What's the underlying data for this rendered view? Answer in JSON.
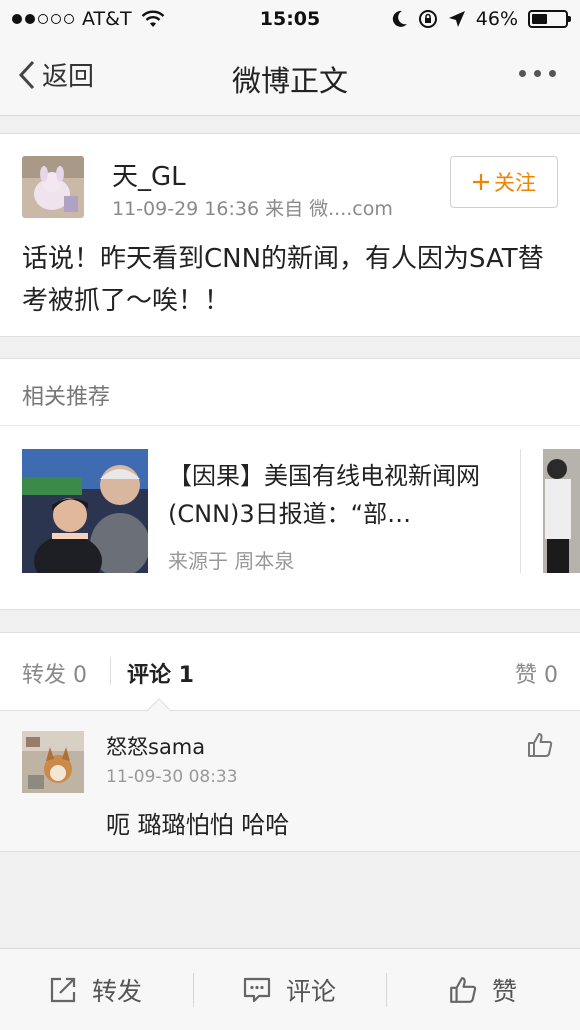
{
  "status_bar": {
    "carrier": "AT&T",
    "time": "15:05",
    "battery": "46%",
    "battery_level": 0.46,
    "signal_bars": 2
  },
  "nav": {
    "back_label": "返回",
    "title": "微博正文"
  },
  "post": {
    "author": "天_GL",
    "meta": "11-09-29 16:36  来自 微....com",
    "follow_label": "关注",
    "text": "话说！昨天看到CNN的新闻，有人因为SAT替考被抓了～唉！！"
  },
  "related": {
    "heading": "相关推荐",
    "items": [
      {
        "title": "【因果】美国有线电视新闻网(CNN)3日报道：“部…",
        "source": "来源于 周本泉"
      }
    ]
  },
  "comments_section": {
    "tab_repost": "转发 0",
    "tab_comment": "评论 1",
    "tab_like": "赞 0",
    "items": [
      {
        "author": "怒怒sama",
        "time": "11-09-30 08:33",
        "text": "呃 璐璐怕怕 哈哈"
      }
    ]
  },
  "bottom_bar": {
    "repost_label": "转发",
    "comment_label": "评论",
    "like_label": "赞"
  },
  "colors": {
    "accent": "#f08300",
    "background": "#f0f0f0"
  }
}
